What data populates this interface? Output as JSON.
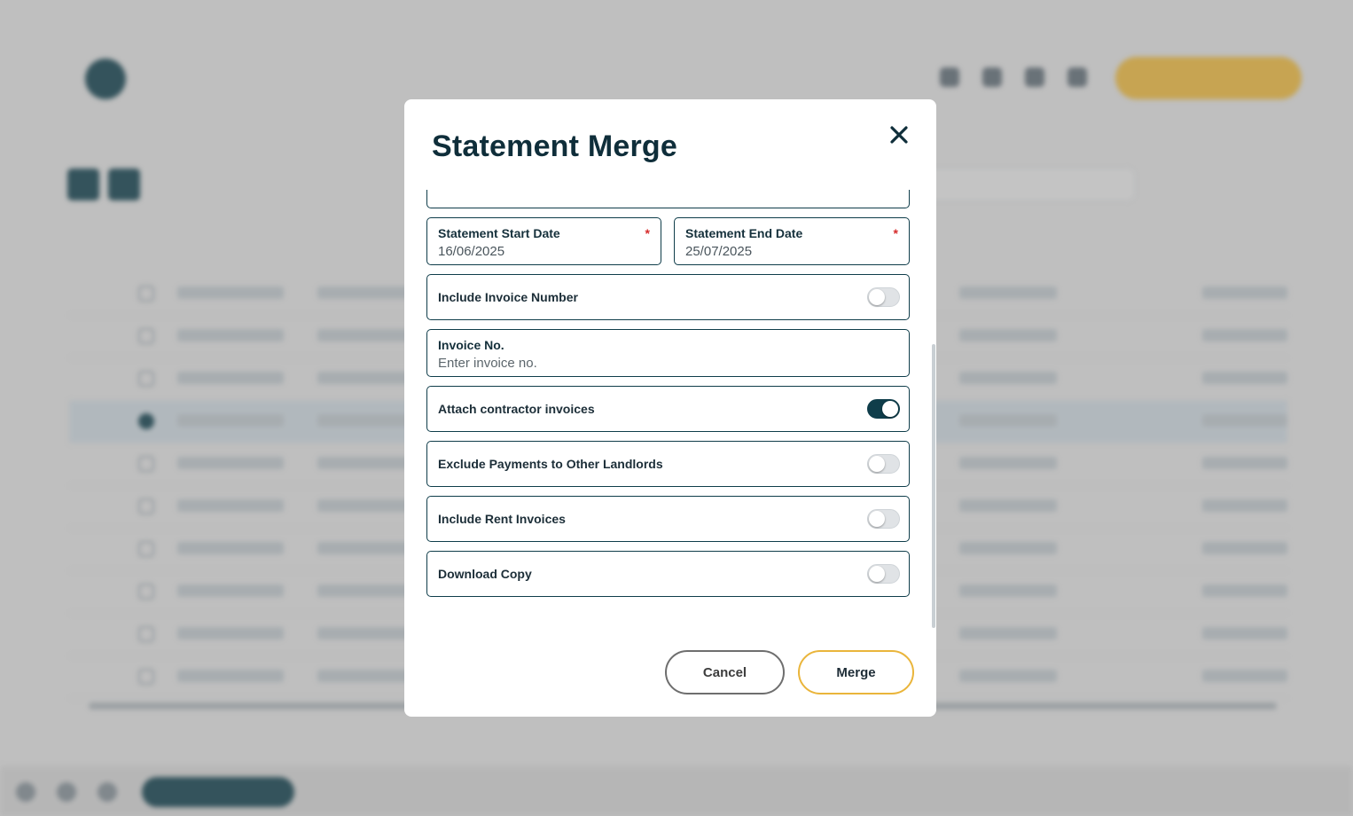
{
  "colors": {
    "primary": "#0f3d4a",
    "accent": "#eab53b",
    "required": "#d62b2b"
  },
  "modal": {
    "title": "Statement Merge",
    "close_icon": "close-icon",
    "fields": {
      "start_date": {
        "label": "Statement Start Date",
        "value": "16/06/2025",
        "required_mark": "*"
      },
      "end_date": {
        "label": "Statement End Date",
        "value": "25/07/2025",
        "required_mark": "*"
      },
      "invoice_no": {
        "label": "Invoice No.",
        "placeholder": "Enter invoice no.",
        "value": ""
      }
    },
    "toggles": {
      "include_invoice_number": {
        "label": "Include Invoice Number",
        "on": false
      },
      "attach_contractor_invoices": {
        "label": "Attach contractor invoices",
        "on": true
      },
      "exclude_payments": {
        "label": "Exclude Payments to Other Landlords",
        "on": false
      },
      "include_rent_invoices": {
        "label": "Include Rent Invoices",
        "on": false
      },
      "download_copy": {
        "label": "Download Copy",
        "on": false
      }
    },
    "buttons": {
      "cancel": "Cancel",
      "merge": "Merge"
    }
  }
}
